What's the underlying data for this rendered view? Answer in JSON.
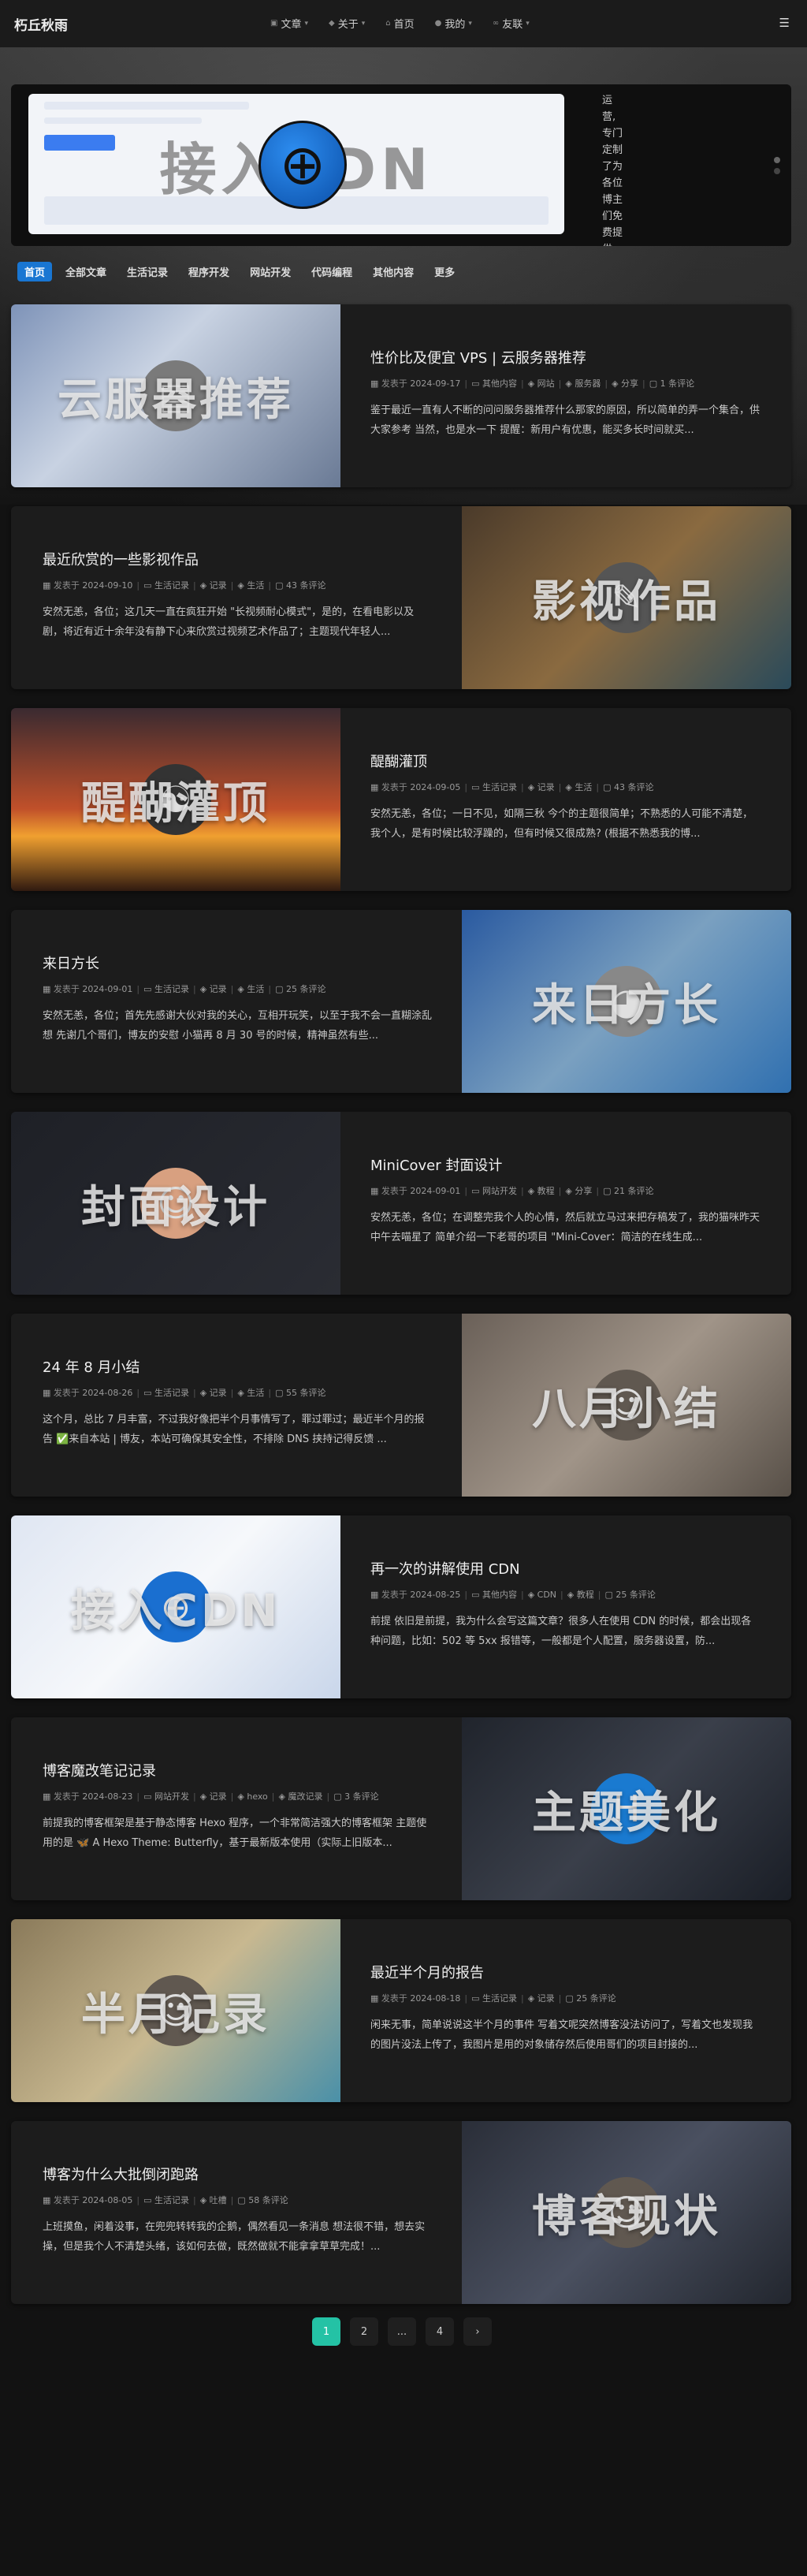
{
  "brand": "朽丘秋雨",
  "nav": {
    "items": [
      {
        "label": "文章",
        "icon": "article-icon"
      },
      {
        "label": "关于",
        "icon": "about-icon"
      },
      {
        "label": "首页",
        "icon": "home-icon"
      },
      {
        "label": "我的",
        "icon": "user-icon"
      },
      {
        "label": "友联",
        "icon": "link-icon"
      }
    ]
  },
  "banner": {
    "title": "接入CDN",
    "side_text": "运营,专门定制了为各位博主们免费提供CD"
  },
  "categories": [
    "首页",
    "全部文章",
    "生活记录",
    "程序开发",
    "网站开发",
    "代码编程",
    "其他内容",
    "更多"
  ],
  "posts": [
    {
      "title": "性价比及便宜 VPS | 云服务器推荐",
      "date": "2024-09-17",
      "category": "其他内容",
      "tags": [
        "网站",
        "服务器",
        "分享"
      ],
      "comments": "1 条评论",
      "excerpt": "鉴于最近一直有人不断的问问服务器推荐什么那家的原因，所以简单的弄一个集合，供大家参考 当然，也是水一下 提醒：新用户有优惠，能买多长时间就买...",
      "thumb_text": "云服器推荐"
    },
    {
      "title": "最近欣赏的一些影视作品",
      "date": "2024-09-10",
      "category": "生活记录",
      "tags": [
        "记录",
        "生活"
      ],
      "comments": "43 条评论",
      "excerpt": "安然无恙，各位；这几天一直在疯狂开始 \"长视频耐心模式\"，是的，在看电影以及剧，将近有近十余年没有静下心来欣赏过视频艺术作品了；主题现代年轻人...",
      "thumb_text": "影视作品"
    },
    {
      "title": "醍醐灌顶",
      "date": "2024-09-05",
      "category": "生活记录",
      "tags": [
        "记录",
        "生活"
      ],
      "comments": "43 条评论",
      "excerpt": "安然无恙，各位；一日不见，如隔三秋 今个的主题很简单；不熟悉的人可能不清楚，我个人，是有时候比较浮躁的，但有时候又很成熟? (根据不熟悉我的博...",
      "thumb_text": "醍醐灌顶"
    },
    {
      "title": "来日方长",
      "date": "2024-09-01",
      "category": "生活记录",
      "tags": [
        "记录",
        "生活"
      ],
      "comments": "25 条评论",
      "excerpt": "安然无恙，各位；首先先感谢大伙对我的关心，互相开玩笑，以至于我不会一直糊涂乱想 先谢几个哥们，博友的安慰 小猫再 8 月 30 号的时候，精神虽然有些...",
      "thumb_text": "来日方长"
    },
    {
      "title": "MiniCover 封面设计",
      "date": "2024-09-01",
      "category": "网站开发",
      "tags": [
        "教程",
        "分享"
      ],
      "comments": "21 条评论",
      "excerpt": "安然无恙，各位；在调整完我个人的心情，然后就立马过来把存稿发了，我的猫咪昨天中午去喵星了 简单介绍一下老哥的项目 \"Mini-Cover：简洁的在线生成...",
      "thumb_text": "封面设计"
    },
    {
      "title": "24 年 8 月小结",
      "date": "2024-08-26",
      "category": "生活记录",
      "tags": [
        "记录",
        "生活"
      ],
      "comments": "55 条评论",
      "excerpt": "这个月，总比 7 月丰富，不过我好像把半个月事情写了，罪过罪过；最近半个月的报告 ✅来自本站 | 博友，本站可确保其安全性，不排除 DNS 挟持记得反馈 ...",
      "thumb_text": "八月小结"
    },
    {
      "title": "再一次的讲解使用 CDN",
      "date": "2024-08-25",
      "category": "其他内容",
      "tags": [
        "CDN",
        "教程"
      ],
      "comments": "25 条评论",
      "excerpt": "前提 依旧是前提，我为什么会写这篇文章？很多人在使用 CDN 的时候，都会出现各种问题，比如：502 等 5xx 报错等，一般都是个人配置，服务器设置，防...",
      "thumb_text": "接入CDN"
    },
    {
      "title": "博客魔改笔记记录",
      "date": "2024-08-23",
      "category": "网站开发",
      "tags": [
        "记录",
        "hexo",
        "魔改记录"
      ],
      "comments": "3 条评论",
      "excerpt": "前提我的博客框架是基于静态博客 Hexo 程序，一个非常简洁强大的博客框架 主题使用的是 🦋 A Hexo Theme: Butterfly，基于最新版本使用（实际上旧版本...",
      "thumb_text": "主题美化"
    },
    {
      "title": "最近半个月的报告",
      "date": "2024-08-18",
      "category": "生活记录",
      "tags": [
        "记录"
      ],
      "comments": "25 条评论",
      "excerpt": "闲来无事，简单说说这半个月的事件 写着文呢突然博客没法访问了，写着文也发现我的图片没法上传了，我图片是用的对象储存然后使用哥们的项目封接的...",
      "thumb_text": "半月记录"
    },
    {
      "title": "博客为什么大批倒闭跑路",
      "date": "2024-08-05",
      "category": "生活记录",
      "tags": [
        "吐槽"
      ],
      "comments": "58 条评论",
      "excerpt": "上班摸鱼，闲着没事，在兜兜转转我的企鹅，偶然看见一条消息 想法很不错，想去实操，但是我个人不清楚头绪，该如何去做，既然做就不能拿拿草草完成！...",
      "thumb_text": "博客现状"
    }
  ],
  "labels": {
    "posted_on": "发表于"
  },
  "pagination": [
    "1",
    "2",
    "...",
    "4",
    "›"
  ]
}
